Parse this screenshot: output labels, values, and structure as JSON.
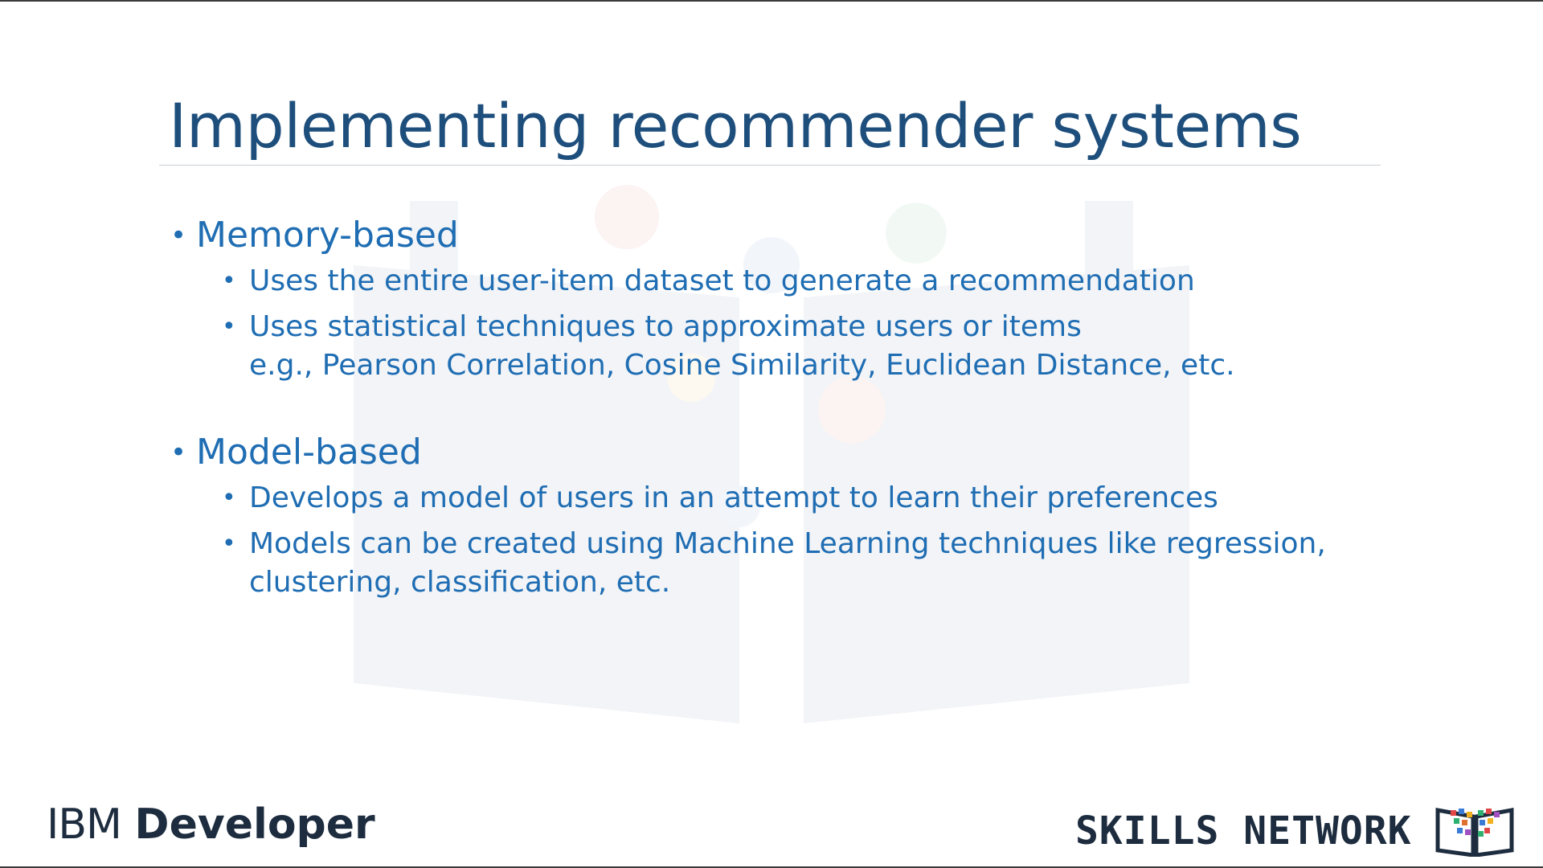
{
  "slide": {
    "title": "Implementing recommender systems",
    "sections": [
      {
        "heading": "Memory-based",
        "points": [
          {
            "lines": [
              "Uses the entire user-item dataset to generate a recommendation"
            ]
          },
          {
            "lines": [
              "Uses statistical techniques to approximate users or items",
              "e.g., Pearson Correlation, Cosine Similarity, Euclidean Distance, etc."
            ]
          }
        ]
      },
      {
        "heading": "Model-based",
        "points": [
          {
            "lines": [
              "Develops a model of users in an attempt to learn their preferences"
            ]
          },
          {
            "lines": [
              "Models can be created using Machine Learning techniques like regression,",
              "clustering, classification, etc."
            ]
          }
        ]
      }
    ]
  },
  "footer": {
    "left_logo_prefix": "IBM",
    "left_logo_suffix": "Developer",
    "right_logo_text": "SKILLS NETWORK"
  },
  "colors": {
    "title": "#1e4f7c",
    "body_text": "#1f6db3",
    "logo_text": "#1d2c3e"
  },
  "icons": {
    "bullet": "bullet-icon",
    "skills_logo": "open-book-icon"
  }
}
